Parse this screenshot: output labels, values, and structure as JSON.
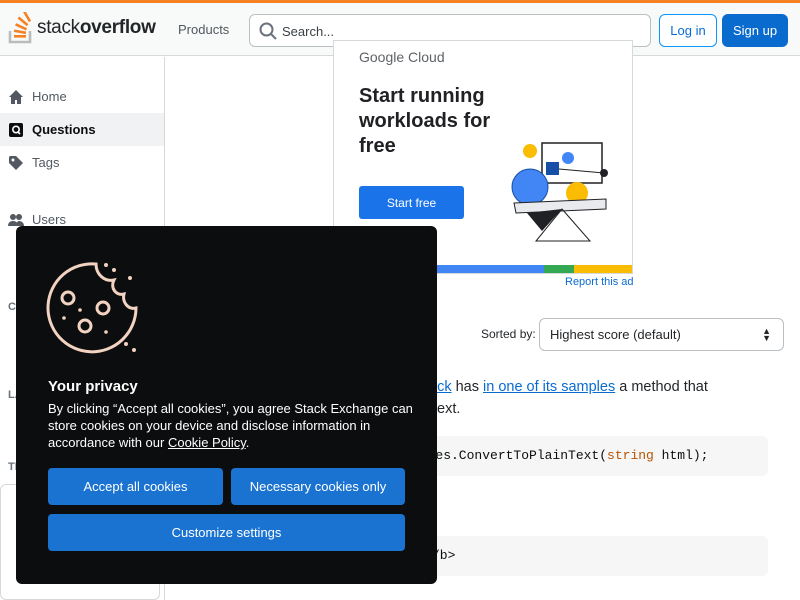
{
  "header": {
    "logo": {
      "text_light": "stack",
      "text_bold": "overflow"
    },
    "products_label": "Products",
    "search": {
      "placeholder": "Search..."
    },
    "login_label": "Log in",
    "signup_label": "Sign up"
  },
  "sidebar": {
    "items": [
      {
        "label": "Home",
        "icon": "home-icon"
      },
      {
        "label": "Questions",
        "icon": "questions-icon"
      },
      {
        "label": "Tags",
        "icon": "tag-icon"
      },
      {
        "label": "Users",
        "icon": "users-icon"
      }
    ],
    "fragments": [
      "CO",
      "LA",
      "TE"
    ]
  },
  "ad": {
    "brand": "Google Cloud",
    "headline": "Start running workloads for free",
    "button_label": "Start free",
    "report_label": "Report this ad",
    "stripe_colors": [
      "#4285f4",
      "#34a853",
      "#fbbc04"
    ]
  },
  "sort": {
    "label": "Sorted by:",
    "selected": "Highest score (default)"
  },
  "answer": {
    "prefix": "ack",
    "mid1": " has ",
    "link": "in one of its samples",
    "suffix": " a method that",
    "line2": "ext.",
    "code1_pre": "ities.ConvertToPlainText(",
    "code1_kw": "string",
    "code1_post": " html);",
    "code2": "/b>"
  },
  "cookie": {
    "title": "Your privacy",
    "body_pre": "By clicking “Accept all cookies”, you agree Stack Exchange can store cookies on your device and disclose information in accordance with our ",
    "policy_link": "Cookie Policy",
    "body_post": ".",
    "accept_label": "Accept all cookies",
    "necessary_label": "Necessary cookies only",
    "customize_label": "Customize settings"
  },
  "colors": {
    "accent": "#f48225",
    "primary": "#0a6bcf",
    "cookie_bg": "#0c0d0e",
    "cookie_button": "#1a73d1"
  }
}
